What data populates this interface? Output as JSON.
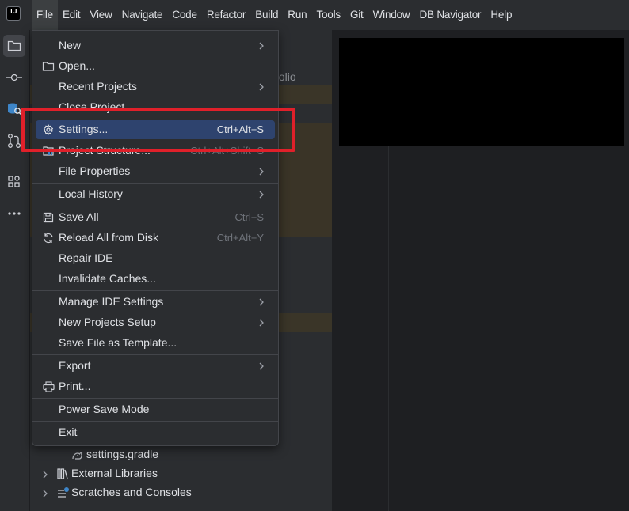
{
  "menubar": {
    "items": [
      {
        "label": "File",
        "active": true
      },
      {
        "label": "Edit"
      },
      {
        "label": "View"
      },
      {
        "label": "Navigate"
      },
      {
        "label": "Code"
      },
      {
        "label": "Refactor"
      },
      {
        "label": "Build"
      },
      {
        "label": "Run"
      },
      {
        "label": "Tools"
      },
      {
        "label": "Git"
      },
      {
        "label": "Window"
      },
      {
        "label": "DB Navigator"
      },
      {
        "label": "Help"
      }
    ]
  },
  "app_logo": "IJ",
  "project_panel": {
    "partial_text": "folio",
    "tree": [
      {
        "label": "settings.gradle",
        "icon": "gradle-icon"
      },
      {
        "label": "External Libraries",
        "icon": "library-icon"
      },
      {
        "label": "Scratches and Consoles",
        "icon": "scratches-icon"
      }
    ]
  },
  "file_menu": {
    "new": "New",
    "open": "Open...",
    "recent_projects": "Recent Projects",
    "close_project": "Close Project",
    "settings": "Settings...",
    "settings_shortcut": "Ctrl+Alt+S",
    "project_structure": "Project Structure...",
    "project_structure_shortcut": "Ctrl+Alt+Shift+S",
    "file_properties": "File Properties",
    "local_history": "Local History",
    "save_all": "Save All",
    "save_all_shortcut": "Ctrl+S",
    "reload": "Reload All from Disk",
    "reload_shortcut": "Ctrl+Alt+Y",
    "repair_ide": "Repair IDE",
    "invalidate_caches": "Invalidate Caches...",
    "manage_ide_settings": "Manage IDE Settings",
    "new_projects_setup": "New Projects Setup",
    "save_as_template": "Save File as Template...",
    "export": "Export",
    "print": "Print...",
    "power_save": "Power Save Mode",
    "exit": "Exit"
  },
  "colors": {
    "highlight_item": "#2e436e",
    "annotation_box": "#e0202a"
  }
}
